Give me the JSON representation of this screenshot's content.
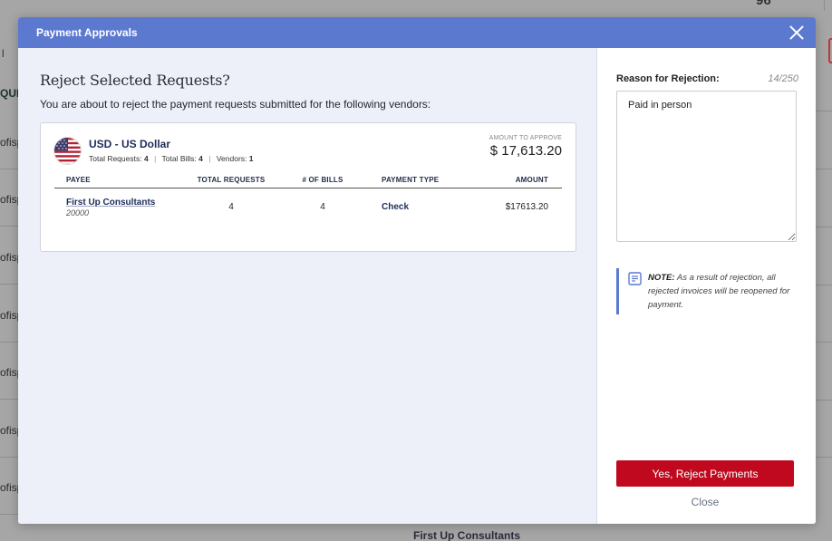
{
  "background": {
    "top_number": "96",
    "col_header": "QUE",
    "bar_text": "l",
    "row_text": "ofisp",
    "bottom_text": "First Up Consultants"
  },
  "modal": {
    "title": "Payment Approvals",
    "heading": "Reject Selected Requests?",
    "subtext": "You are about to reject the payment requests submitted for the following vendors:"
  },
  "currency": {
    "name": "USD - US Dollar",
    "flag_icon": "us-flag-icon",
    "total_requests_label": "Total Requests:",
    "total_requests": "4",
    "total_bills_label": "Total Bills:",
    "total_bills": "4",
    "vendors_label": "Vendors:",
    "vendors": "1",
    "amount_label": "AMOUNT TO APPROVE",
    "amount": "$ 17,613.20"
  },
  "table": {
    "headers": {
      "payee": "PAYEE",
      "total_requests": "TOTAL REQUESTS",
      "bills": "# OF BILLS",
      "payment_type": "PAYMENT TYPE",
      "amount": "AMOUNT"
    },
    "rows": [
      {
        "payee": "First Up Consultants",
        "payee_id": "20000",
        "total_requests": "4",
        "bills": "4",
        "payment_type": "Check",
        "amount": "$17613.20"
      }
    ]
  },
  "reason": {
    "label": "Reason for Rejection:",
    "count": "14/250",
    "value": "Paid in person"
  },
  "note": {
    "prefix": "NOTE:",
    "text": "As a result of rejection, all rejected invoices will be reopened for payment."
  },
  "actions": {
    "reject_label": "Yes, Reject Payments",
    "close_label": "Close"
  },
  "colors": {
    "header_blue": "#5c79d0",
    "reject_red": "#c0091f",
    "pane_bg": "#eef0f9"
  }
}
